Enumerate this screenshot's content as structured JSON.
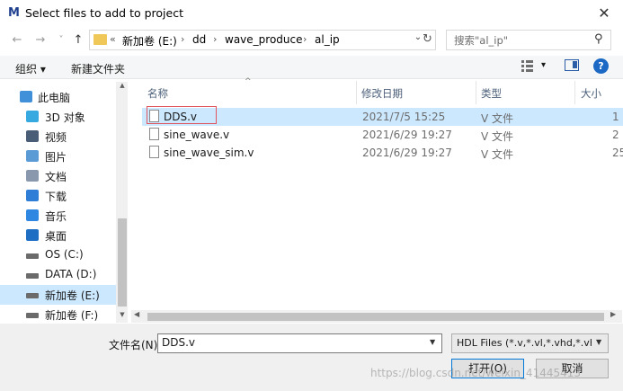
{
  "window": {
    "title": "Select files to add to project",
    "app_icon": "M",
    "close": "✕"
  },
  "nav": {
    "back": "←",
    "forward": "→",
    "recent": "˅",
    "up": "↑"
  },
  "address": {
    "prefix": "«",
    "crumbs": [
      "新加卷 (E:)",
      "dd",
      "wave_produce",
      "al_ip"
    ],
    "separator": "›"
  },
  "search": {
    "placeholder": "搜索\"al_ip\""
  },
  "toolbar": {
    "organize": "组织 ▾",
    "new_folder": "新建文件夹",
    "view_caret": "▾",
    "help": "?"
  },
  "sidebar": {
    "items": [
      {
        "label": "此电脑",
        "icon": "computer-icon",
        "color": "#3f8fd9"
      },
      {
        "label": "3D 对象",
        "icon": "cube-3d-icon",
        "color": "#36a9e1"
      },
      {
        "label": "视频",
        "icon": "video-icon",
        "color": "#4a5d77"
      },
      {
        "label": "图片",
        "icon": "pictures-icon",
        "color": "#5b9bd5"
      },
      {
        "label": "文档",
        "icon": "documents-icon",
        "color": "#8a98ad"
      },
      {
        "label": "下载",
        "icon": "download-icon",
        "color": "#2e7dd7"
      },
      {
        "label": "音乐",
        "icon": "music-icon",
        "color": "#2e87e0"
      },
      {
        "label": "桌面",
        "icon": "desktop-icon",
        "color": "#1e6fc4"
      },
      {
        "label": "OS (C:)",
        "icon": "drive-os-icon",
        "color": "#6b6b6b"
      },
      {
        "label": "DATA (D:)",
        "icon": "drive-icon",
        "color": "#6b6b6b"
      },
      {
        "label": "新加卷 (E:)",
        "icon": "drive-icon",
        "color": "#6b6b6b"
      },
      {
        "label": "新加卷 (F:)",
        "icon": "drive-icon",
        "color": "#6b6b6b"
      }
    ]
  },
  "columns": {
    "name": "名称",
    "date": "修改日期",
    "type": "类型",
    "size": "大小"
  },
  "files": [
    {
      "name": "DDS.v",
      "date": "2021/7/5 15:25",
      "type": "V 文件",
      "size": "1"
    },
    {
      "name": "sine_wave.v",
      "date": "2021/6/29 19:27",
      "type": "V 文件",
      "size": "2"
    },
    {
      "name": "sine_wave_sim.v",
      "date": "2021/6/29 19:27",
      "type": "V 文件",
      "size": "25"
    }
  ],
  "bottom": {
    "filename_label": "文件名(N):",
    "filename_value": "DDS.v",
    "filter_value": "HDL Files (*.v,*.vl,*.vhd,*.vhdl,",
    "open_button": "打开(O)",
    "cancel_button": "取消"
  },
  "watermark": "https://blog.csdn.net/weixin_41445413"
}
